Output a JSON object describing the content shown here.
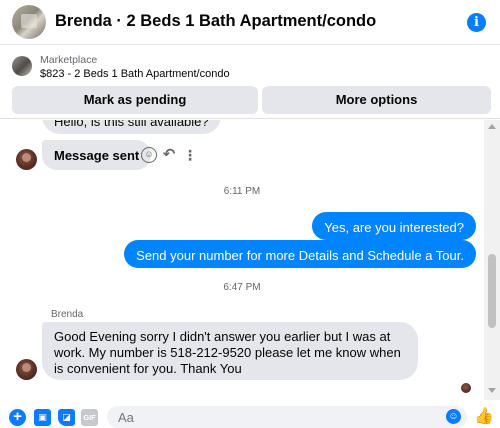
{
  "header": {
    "title": "Brenda · 2 Beds 1 Bath Apartment/condo",
    "avatar_icon": "listing-photo-avatar",
    "info_icon": "info-icon",
    "info_glyph": "i"
  },
  "listing": {
    "source": "Marketplace",
    "price_title": "$823 - 2 Beds 1 Bath Apartment/condo",
    "mark_pending_label": "Mark as pending",
    "more_options_label": "More options"
  },
  "messages": {
    "previous": "Hello, is this still available?",
    "sent": "Message sent",
    "time1": "6:11 PM",
    "out1": "Yes, are you interested?",
    "out2": "Send your number for more Details and Schedule a Tour.",
    "time2": "6:47 PM",
    "sender_name": "Brenda",
    "long_reply": "Good Evening sorry I didn't answer you earlier but I was at work. My number is 518-212-9520 please let me know when is convenient for you. Thank You"
  },
  "composer": {
    "placeholder": "Aa",
    "icons": [
      "plus-icon",
      "photo-icon",
      "sticker-icon",
      "gif-icon",
      "emoji-icon",
      "like-icon"
    ],
    "gif_label": "GIF"
  },
  "colors": {
    "accent": "#0a7cff",
    "outgoing_bubble": "#0084ff",
    "incoming_bubble": "#e4e6eb",
    "button_bg": "#e4e6eb"
  }
}
